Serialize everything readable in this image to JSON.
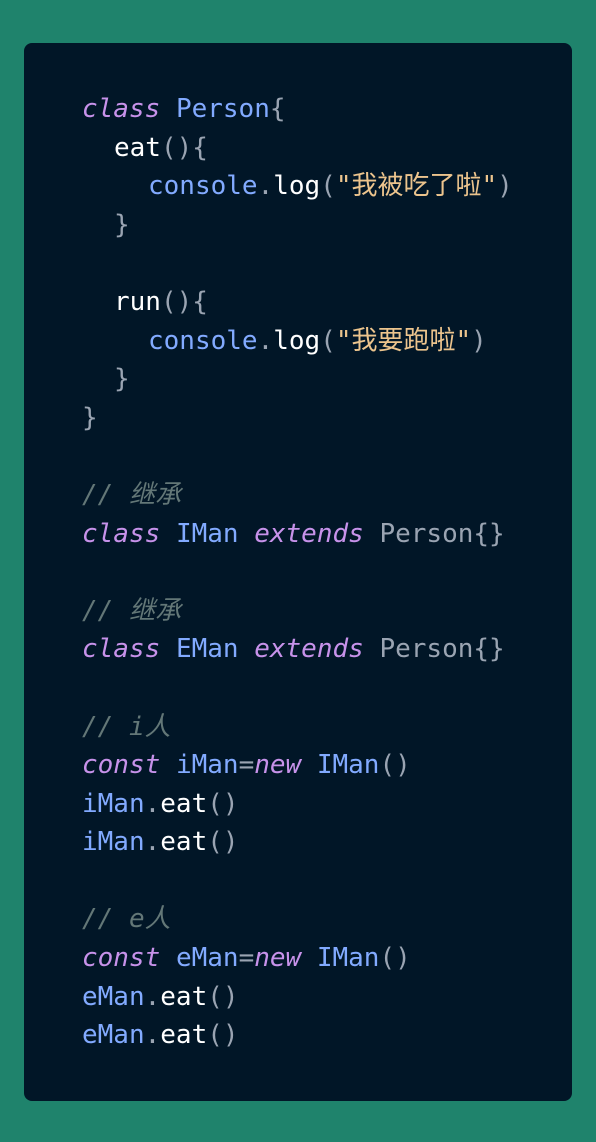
{
  "code": {
    "person_class": {
      "kw_class": "class",
      "name": "Person",
      "open": "{",
      "eat_method": {
        "name": "eat",
        "parens": "()",
        "open": "{",
        "console": "console",
        "dot": ".",
        "log": "log",
        "open_paren": "(",
        "string": "\"我被吃了啦\"",
        "close_paren": ")",
        "close": "}"
      },
      "run_method": {
        "name": "run",
        "parens": "()",
        "open": "{",
        "console": "console",
        "dot": ".",
        "log": "log",
        "open_paren": "(",
        "string": "\"我要跑啦\"",
        "close_paren": ")",
        "close": "}"
      },
      "close": "}"
    },
    "iman_comment": "// 继承",
    "iman_class": {
      "kw_class": "class",
      "name": "IMan",
      "kw_extends": "extends",
      "parent": "Person{}"
    },
    "eman_comment": "// 继承",
    "eman_class": {
      "kw_class": "class",
      "name": "EMan",
      "kw_extends": "extends",
      "parent": "Person{}"
    },
    "i_comment": "// i人",
    "i_block": {
      "kw_const": "const",
      "var": "iMan",
      "eq": "=",
      "kw_new": "new",
      "ctor": "IMan",
      "parens": "()",
      "calls": [
        {
          "obj": "iMan",
          "dot": ".",
          "method": "eat",
          "parens": "()"
        },
        {
          "obj": "iMan",
          "dot": ".",
          "method": "eat",
          "parens": "()"
        }
      ]
    },
    "e_comment": "// e人",
    "e_block": {
      "kw_const": "const",
      "var": "eMan",
      "eq": "=",
      "kw_new": "new",
      "ctor": "IMan",
      "parens": "()",
      "calls": [
        {
          "obj": "eMan",
          "dot": ".",
          "method": "eat",
          "parens": "()"
        },
        {
          "obj": "eMan",
          "dot": ".",
          "method": "eat",
          "parens": "()"
        }
      ]
    }
  },
  "colors": {
    "page_background": "#1f836c",
    "editor_background": "#011627",
    "keyword": "#c792ea",
    "class_name": "#82aaff",
    "string": "#ecc48d",
    "comment": "#637777"
  }
}
